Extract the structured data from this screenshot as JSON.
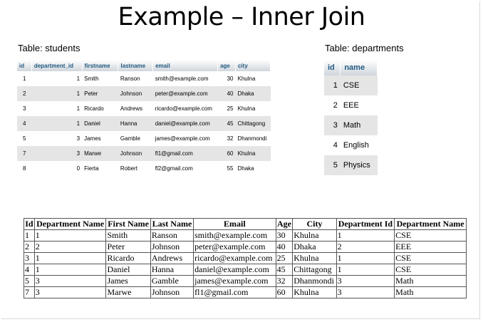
{
  "title": "Example – Inner Join",
  "students": {
    "label": "Table: students",
    "columns": [
      "id",
      "department_id",
      "firstname",
      "lastname",
      "email",
      "age",
      "city"
    ],
    "rows": [
      [
        "1",
        "1",
        "Smith",
        "Ranson",
        "smith@example.com",
        "30",
        "Khulna"
      ],
      [
        "2",
        "1",
        "Peter",
        "Johnson",
        "peter@example.com",
        "40",
        "Dhaka"
      ],
      [
        "3",
        "1",
        "Ricardo",
        "Andrews",
        "ricardo@example.com",
        "25",
        "Khulna"
      ],
      [
        "4",
        "1",
        "Daniel",
        "Hanna",
        "daniel@example.com",
        "45",
        "Chittagong"
      ],
      [
        "5",
        "3",
        "James",
        "Gamble",
        "james@example.com",
        "32",
        "Dhanmondi"
      ],
      [
        "7",
        "3",
        "Marwe",
        "Johnson",
        "fl1@gmail.com",
        "60",
        "Khulna"
      ],
      [
        "8",
        "0",
        "Fierta",
        "Robert",
        "fl2@gmail.com",
        "55",
        "Dhaka"
      ]
    ]
  },
  "departments": {
    "label": "Table: departments",
    "columns": [
      "id",
      "name"
    ],
    "rows": [
      [
        "1",
        "CSE"
      ],
      [
        "2",
        "EEE"
      ],
      [
        "3",
        "Math"
      ],
      [
        "4",
        "English"
      ],
      [
        "5",
        "Physics"
      ]
    ]
  },
  "result": {
    "columns": [
      "Id",
      "Department Name",
      "First Name",
      "Last Name",
      "Email",
      "Age",
      "City",
      "Department Id",
      "Department Name"
    ],
    "rows": [
      [
        "1",
        "1",
        "Smith",
        "Ranson",
        "smith@example.com",
        "30",
        "Khulna",
        "1",
        "CSE"
      ],
      [
        "2",
        "2",
        "Peter",
        "Johnson",
        "peter@example.com",
        "40",
        "Dhaka",
        "2",
        "EEE"
      ],
      [
        "3",
        "1",
        "Ricardo",
        "Andrews",
        "ricardo@example.com",
        "25",
        "Khulna",
        "1",
        "CSE"
      ],
      [
        "4",
        "1",
        "Daniel",
        "Hanna",
        "daniel@example.com",
        "45",
        "Chittagong",
        "1",
        "CSE"
      ],
      [
        "5",
        "3",
        "James",
        "Gamble",
        "james@example.com",
        "32",
        "Dhanmondi",
        "3",
        "Math"
      ],
      [
        "7",
        "3",
        "Marwe",
        "Johnson",
        "fl1@gmail.com",
        "60",
        "Khulna",
        "3",
        "Math"
      ]
    ]
  },
  "colors": {
    "header_text": "#235a81",
    "row_alt": "#e5e5e5"
  }
}
